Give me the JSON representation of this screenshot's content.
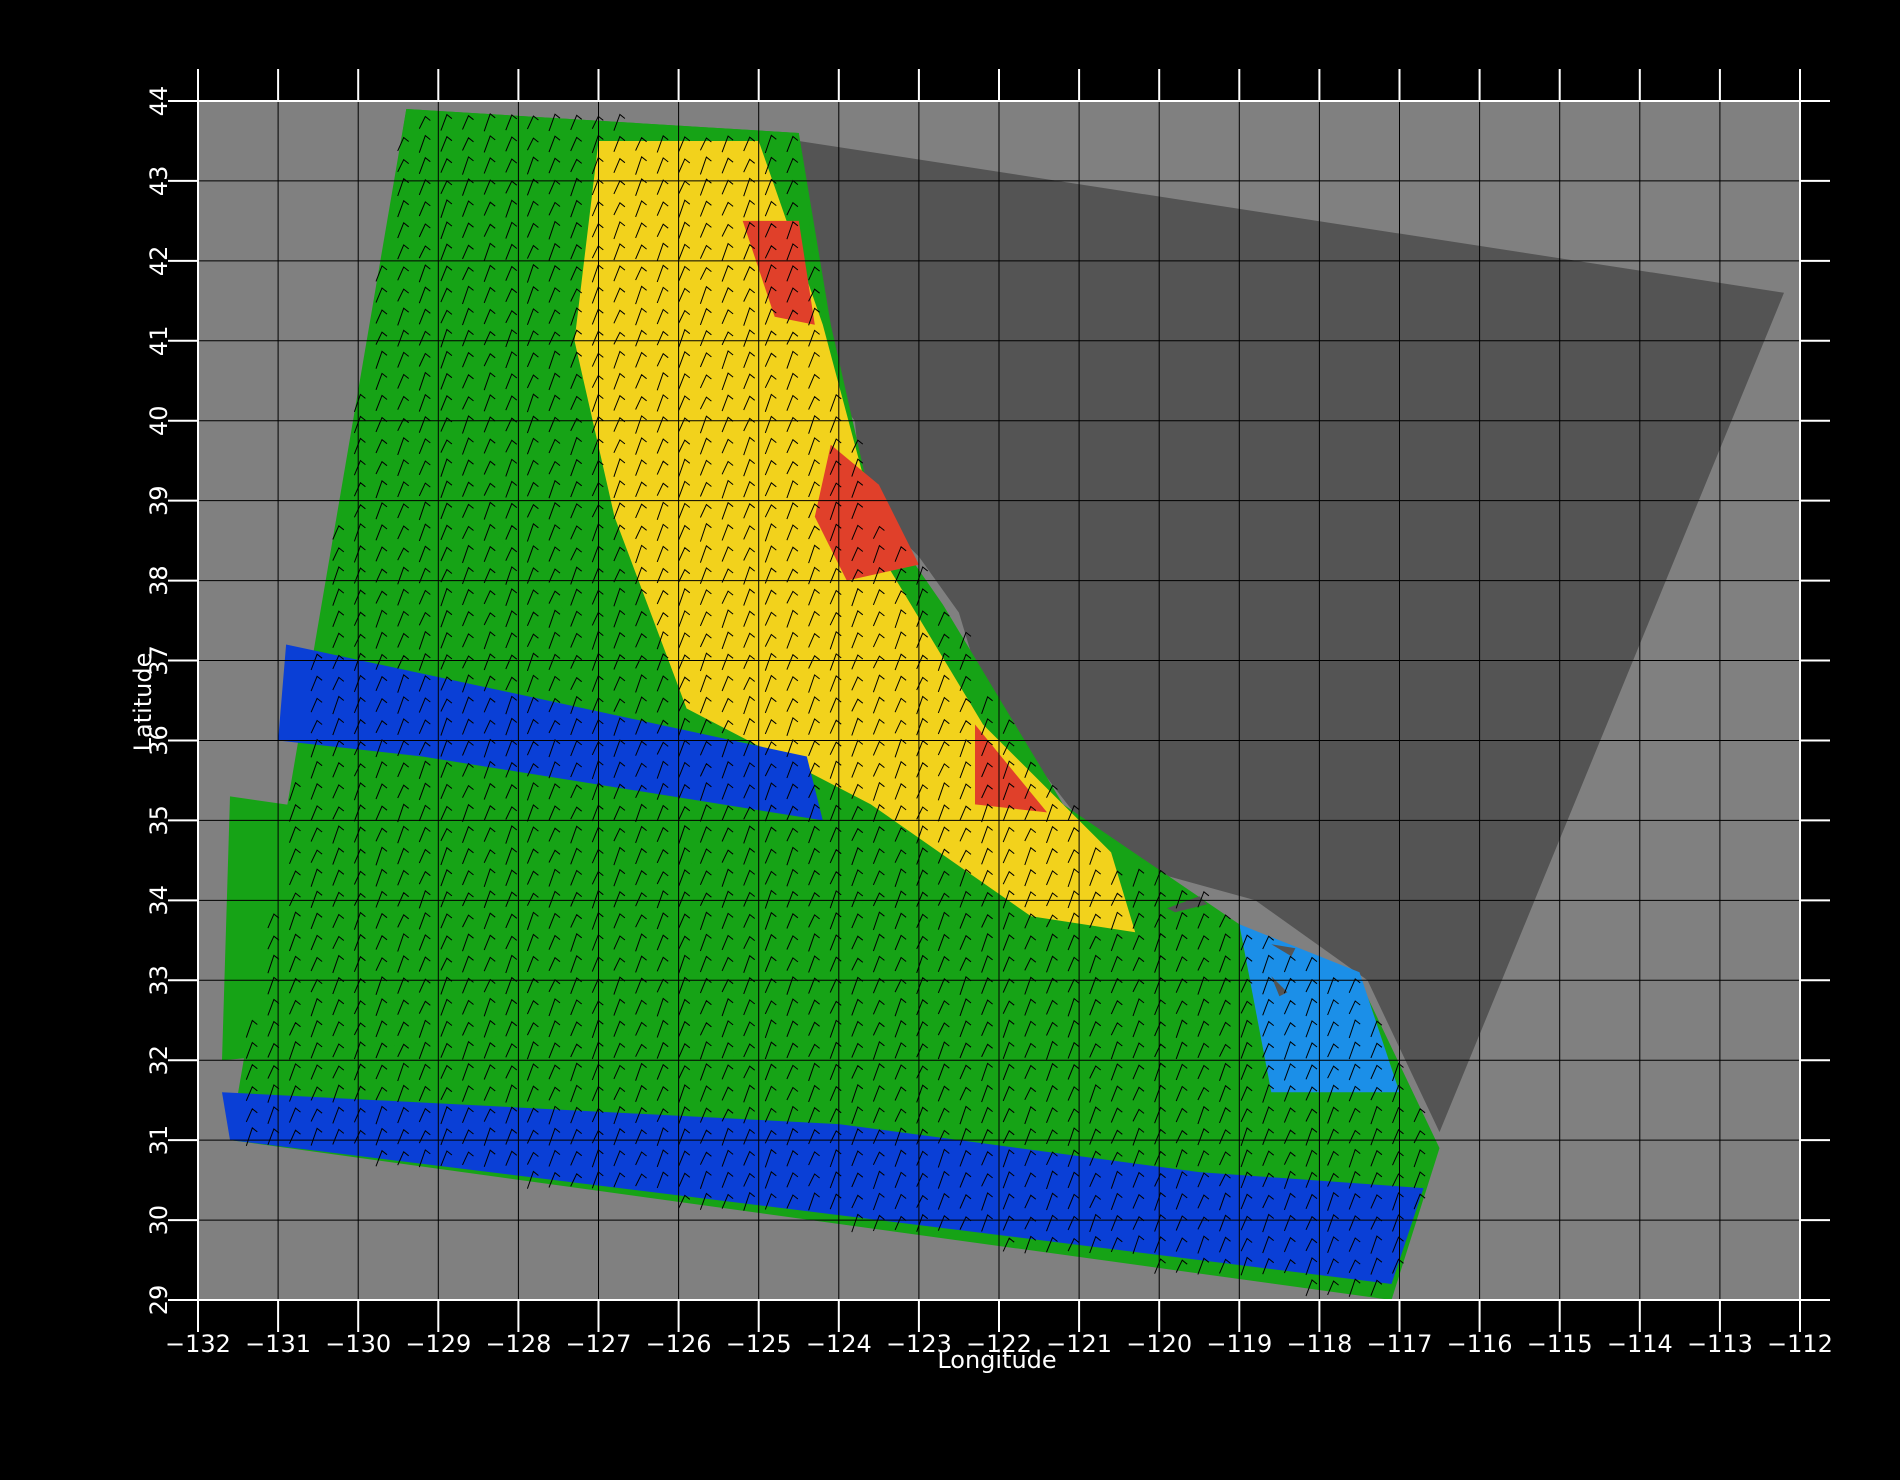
{
  "figure": {
    "background_color": "#000000",
    "plot_background_color": "#808080",
    "land_color": "#545454",
    "grid_color": "#000000",
    "axis_color": "#ffffff",
    "vector_color": "#000000",
    "grid": true
  },
  "axes": {
    "x": {
      "label": "Longitude",
      "range": [
        -132,
        -112
      ],
      "ticks": [
        -132,
        -131,
        -130,
        -129,
        -128,
        -127,
        -126,
        -125,
        -124,
        -123,
        -122,
        -121,
        -120,
        -119,
        -118,
        -117,
        -116,
        -115,
        -114,
        -113,
        -112
      ],
      "tick_labels": [
        "−132",
        "−131",
        "−130",
        "−129",
        "−128",
        "−127",
        "−126",
        "−125",
        "−124",
        "−123",
        "−122",
        "−121",
        "−120",
        "−119",
        "−118",
        "−117",
        "−116",
        "−115",
        "−114",
        "−113",
        "−112"
      ]
    },
    "y": {
      "label": "Latitude",
      "range": [
        29,
        44
      ],
      "ticks": [
        29,
        30,
        31,
        32,
        33,
        34,
        35,
        36,
        37,
        38,
        39,
        40,
        41,
        42,
        43,
        44
      ],
      "tick_labels": [
        "29",
        "30",
        "31",
        "32",
        "33",
        "34",
        "35",
        "36",
        "37",
        "38",
        "39",
        "40",
        "41",
        "42",
        "43",
        "44"
      ]
    }
  },
  "map_layers": {
    "swath_outline": [
      [
        -129.4,
        43.9
      ],
      [
        -124.5,
        43.6
      ],
      [
        -124.1,
        41.2
      ],
      [
        -123.6,
        39.0
      ],
      [
        -122.7,
        37.7
      ],
      [
        -121.2,
        35.2
      ],
      [
        -119.0,
        33.7
      ],
      [
        -117.5,
        33.0
      ],
      [
        -116.5,
        30.9
      ],
      [
        -117.1,
        29.0
      ],
      [
        -131.6,
        31.0
      ],
      [
        -129.4,
        43.9
      ]
    ],
    "land_outline": [
      [
        -124.5,
        43.5
      ],
      [
        -112.2,
        41.6
      ],
      [
        -116.5,
        31.1
      ],
      [
        -117.4,
        33.0
      ],
      [
        -118.8,
        34.0
      ],
      [
        -120.6,
        34.5
      ],
      [
        -121.3,
        35.4
      ],
      [
        -122.2,
        36.6
      ],
      [
        -122.5,
        37.6
      ],
      [
        -123.0,
        38.3
      ],
      [
        -123.7,
        39.0
      ],
      [
        -123.8,
        40.0
      ],
      [
        -124.2,
        40.5
      ],
      [
        -124.2,
        41.5
      ],
      [
        -124.5,
        42.5
      ],
      [
        -124.5,
        43.5
      ]
    ],
    "island_outlines": [
      [
        [
          -119.9,
          33.9
        ],
        [
          -119.5,
          34.05
        ],
        [
          -119.4,
          33.95
        ],
        [
          -119.8,
          33.85
        ]
      ],
      [
        [
          -118.6,
          33.45
        ],
        [
          -118.3,
          33.4
        ],
        [
          -118.35,
          33.3
        ]
      ],
      [
        [
          -118.6,
          33.05
        ],
        [
          -118.4,
          32.85
        ],
        [
          -118.5,
          32.8
        ]
      ]
    ],
    "field_palette": {
      "low": "#0a3fd6",
      "low_light": "#1b8fe8",
      "mid": "#16a316",
      "mid_light": "#42d42a",
      "high": "#f2d21c",
      "highest": "#e0402a"
    },
    "field_zones": [
      {
        "level": "mid",
        "polygon": [
          [
            -129.4,
            43.9
          ],
          [
            -124.5,
            43.6
          ],
          [
            -124.2,
            41.0
          ],
          [
            -127.4,
            37.6
          ],
          [
            -128.3,
            38.6
          ],
          [
            -130.4,
            37.6
          ],
          [
            -129.4,
            43.9
          ]
        ]
      },
      {
        "level": "high",
        "polygon": [
          [
            -127.0,
            43.5
          ],
          [
            -125.0,
            43.5
          ],
          [
            -124.2,
            41.2
          ],
          [
            -123.4,
            38.2
          ],
          [
            -122.2,
            36.2
          ],
          [
            -120.6,
            34.6
          ],
          [
            -120.3,
            33.6
          ],
          [
            -121.6,
            33.8
          ],
          [
            -123.6,
            35.2
          ],
          [
            -125.9,
            36.4
          ],
          [
            -126.8,
            38.8
          ],
          [
            -127.3,
            41.0
          ]
        ]
      },
      {
        "level": "highest",
        "polygon": [
          [
            -125.2,
            42.5
          ],
          [
            -124.5,
            42.5
          ],
          [
            -124.3,
            41.2
          ],
          [
            -124.8,
            41.3
          ]
        ]
      },
      {
        "level": "highest",
        "polygon": [
          [
            -124.1,
            39.7
          ],
          [
            -123.5,
            39.2
          ],
          [
            -123.0,
            38.2
          ],
          [
            -123.9,
            38.0
          ],
          [
            -124.3,
            38.8
          ]
        ]
      },
      {
        "level": "highest",
        "polygon": [
          [
            -122.3,
            36.2
          ],
          [
            -121.4,
            35.1
          ],
          [
            -122.3,
            35.2
          ]
        ]
      },
      {
        "level": "low",
        "polygon": [
          [
            -130.9,
            37.2
          ],
          [
            -128.1,
            36.6
          ],
          [
            -124.4,
            35.8
          ],
          [
            -124.2,
            35.0
          ],
          [
            -129.2,
            35.8
          ],
          [
            -131.0,
            36.0
          ]
        ]
      },
      {
        "level": "mid",
        "polygon": [
          [
            -131.6,
            35.3
          ],
          [
            -126.0,
            34.5
          ],
          [
            -122.6,
            33.7
          ],
          [
            -119.5,
            32.6
          ],
          [
            -119.8,
            31.4
          ],
          [
            -123.2,
            31.6
          ],
          [
            -127.0,
            32.4
          ],
          [
            -131.7,
            32.0
          ]
        ]
      },
      {
        "level": "low",
        "polygon": [
          [
            -131.7,
            31.6
          ],
          [
            -124.0,
            31.2
          ],
          [
            -119.5,
            30.6
          ],
          [
            -116.7,
            30.4
          ],
          [
            -117.1,
            29.2
          ],
          [
            -124.3,
            30.1
          ],
          [
            -131.6,
            31.0
          ]
        ]
      },
      {
        "level": "low_light",
        "polygon": [
          [
            -119.0,
            33.7
          ],
          [
            -117.5,
            33.1
          ],
          [
            -117.0,
            31.6
          ],
          [
            -118.6,
            31.6
          ]
        ]
      }
    ],
    "wind_vectors": "dense field of short black wind barbs over the data swath"
  }
}
